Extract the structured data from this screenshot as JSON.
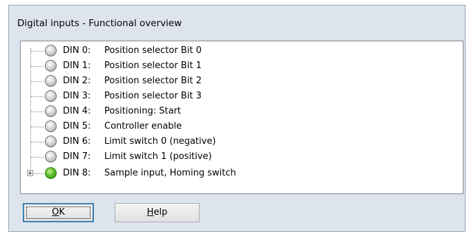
{
  "window": {
    "title": "Digital inputs - Functional overview"
  },
  "inputs": [
    {
      "id": "DIN 0:",
      "label": "Position selector Bit 0",
      "state": "off"
    },
    {
      "id": "DIN 1:",
      "label": "Position selector Bit 1",
      "state": "off"
    },
    {
      "id": "DIN 2:",
      "label": "Position selector Bit 2",
      "state": "off"
    },
    {
      "id": "DIN 3:",
      "label": "Position selector Bit 3",
      "state": "off"
    },
    {
      "id": "DIN 4:",
      "label": "Positioning: Start",
      "state": "off"
    },
    {
      "id": "DIN 5:",
      "label": "Controller enable",
      "state": "off"
    },
    {
      "id": "DIN 6:",
      "label": "Limit switch 0 (negative)",
      "state": "off"
    },
    {
      "id": "DIN 7:",
      "label": "Limit switch 1 (positive)",
      "state": "off"
    },
    {
      "id": "DIN 8:",
      "label": "Sample input,  Homing switch",
      "state": "on",
      "expandable": true
    }
  ],
  "buttons": {
    "ok": {
      "label": "OK",
      "mnemonic": "O",
      "rest": "K"
    },
    "help": {
      "label": "Help",
      "mnemonic": "H",
      "rest": "elp"
    }
  },
  "colors": {
    "led_on": "#5fbd25",
    "led_off": "#c8c8c8",
    "dialog_bg": "#dde4ee"
  },
  "icons": {
    "led_off": "gray-led-icon",
    "led_on": "green-led-icon",
    "expand": "plus-expander-icon"
  }
}
